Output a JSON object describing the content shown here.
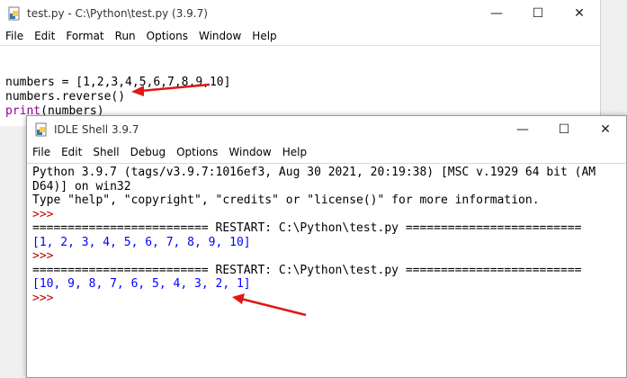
{
  "editor": {
    "title": "test.py - C:\\Python\\test.py (3.9.7)",
    "menu": [
      "File",
      "Edit",
      "Format",
      "Run",
      "Options",
      "Window",
      "Help"
    ],
    "lines": {
      "line1": "numbers = [1,2,3,4,5,6,7,8,9,10]",
      "line2": "numbers.reverse()",
      "line3_builtin": "print",
      "line3_rest": "(numbers)"
    }
  },
  "shell": {
    "title": "IDLE Shell 3.9.7",
    "menu": [
      "File",
      "Edit",
      "Shell",
      "Debug",
      "Options",
      "Window",
      "Help"
    ],
    "banner1": "Python 3.9.7 (tags/v3.9.7:1016ef3, Aug 30 2021, 20:19:38) [MSC v.1929 64 bit (AM",
    "banner2": "D64)] on win32",
    "banner3": "Type \"help\", \"copyright\", \"credits\" or \"license()\" for more information.",
    "prompt": ">>>",
    "restart": "========================= RESTART: C:\\Python\\test.py =========================",
    "output1": "[1, 2, 3, 4, 5, 6, 7, 8, 9, 10]",
    "output2": "[10, 9, 8, 7, 6, 5, 4, 3, 2, 1]"
  },
  "window_controls": {
    "minimize": "—",
    "maximize": "☐",
    "close": "✕"
  },
  "icons": {
    "app": "python-idle-icon"
  },
  "colors": {
    "prompt": "#c00000",
    "output": "#0000ff",
    "builtin": "#900090",
    "arrow": "#e01818"
  }
}
